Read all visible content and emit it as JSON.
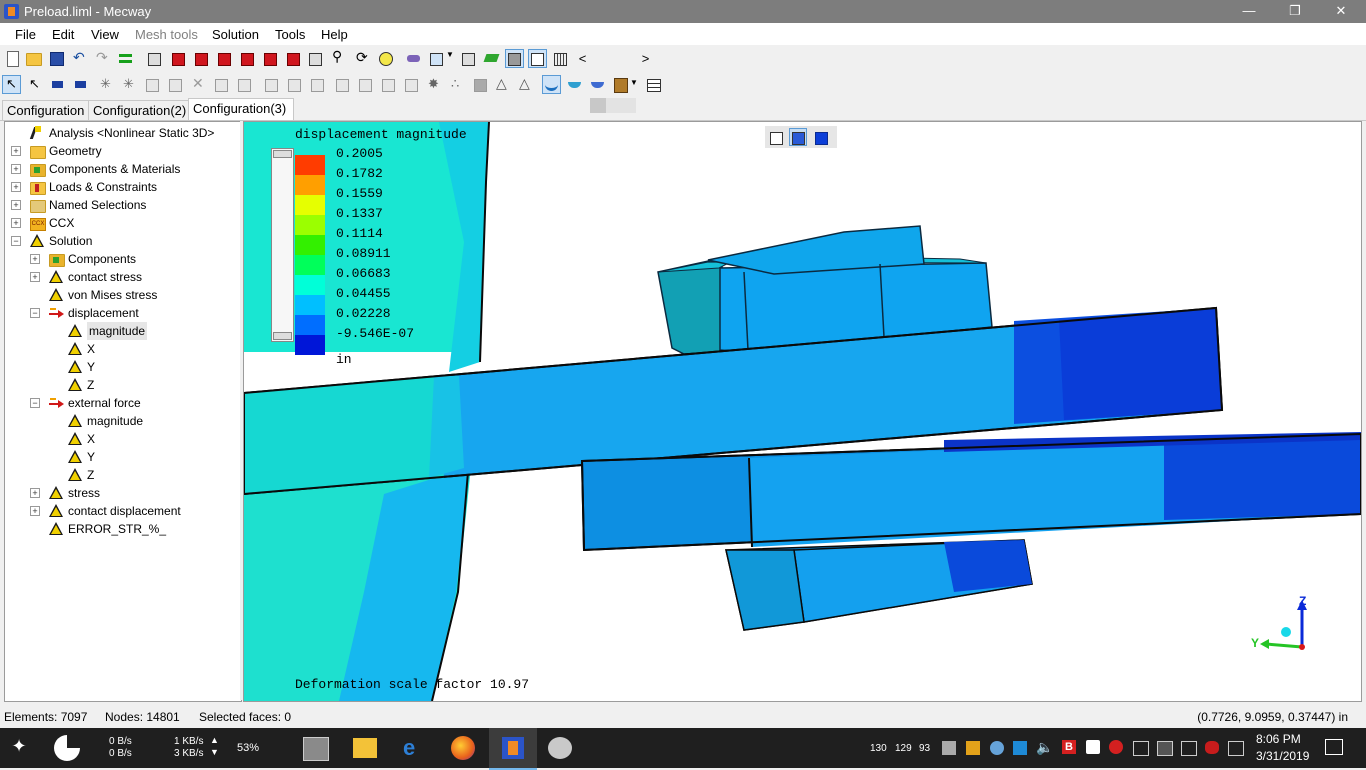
{
  "window": {
    "title": "Preload.liml - Mecway",
    "minimize_glyph": "—",
    "restore_glyph": "❐",
    "close_glyph": "✕"
  },
  "menu": [
    {
      "label": "File",
      "enabled": true
    },
    {
      "label": "Edit",
      "enabled": true
    },
    {
      "label": "View",
      "enabled": true
    },
    {
      "label": "Mesh tools",
      "enabled": false
    },
    {
      "label": "Solution",
      "enabled": true
    },
    {
      "label": "Tools",
      "enabled": true
    },
    {
      "label": "Help",
      "enabled": true
    }
  ],
  "toolbar1": {
    "icons": [
      "new-file-icon",
      "open-folder-icon",
      "save-icon",
      "undo-icon",
      "redo-icon",
      "stack-icon",
      "view-iso-icon",
      "view-front-icon",
      "view-back-icon",
      "view-left-icon",
      "view-right-icon",
      "view-top-icon",
      "view-bottom-icon",
      "zoom-fit-icon",
      "zoom-icon",
      "rotate-icon",
      "pan-icon",
      "layers-icon",
      "select-filter-icon",
      "shade-icon",
      "solid-view-icon",
      "wire-view-icon",
      "mesh-view-icon",
      "scroll-left-icon",
      "scroll-right-icon"
    ],
    "scroll_left": "<",
    "scroll_right": ">"
  },
  "toolbar2": {
    "icons": [
      "select-pointer-icon",
      "select-node-icon",
      "select-edge-icon",
      "select-face-icon",
      "explode-icon",
      "box-icon",
      "solid-icon",
      "delete-icon",
      "split-icon",
      "extrude-icon",
      "copy-icon",
      "mirror-icon",
      "move-icon",
      "rotate-elements-icon",
      "revolve-icon",
      "sweep-icon",
      "refine-icon",
      "merge-icon",
      "tri-icon",
      "tri-outline-icon",
      "warp-active-icon",
      "warp-icon",
      "animate-icon",
      "film-icon",
      "table-icon"
    ]
  },
  "tabs": [
    {
      "label": "Configuration",
      "active": false
    },
    {
      "label": "Configuration(2)",
      "active": false
    },
    {
      "label": "Configuration(3)",
      "active": true
    }
  ],
  "tree": [
    {
      "label": "Analysis <Nonlinear Static 3D>",
      "level": 0,
      "expander": "",
      "icon": "analysis"
    },
    {
      "label": "Geometry",
      "level": 0,
      "expander": "+",
      "icon": "folder"
    },
    {
      "label": "Components & Materials",
      "level": 0,
      "expander": "+",
      "icon": "components"
    },
    {
      "label": "Loads & Constraints",
      "level": 0,
      "expander": "+",
      "icon": "loads"
    },
    {
      "label": "Named Selections",
      "level": 0,
      "expander": "+",
      "icon": "named"
    },
    {
      "label": "CCX",
      "level": 0,
      "expander": "+",
      "icon": "ccx"
    },
    {
      "label": "Solution",
      "level": 0,
      "expander": "-",
      "icon": "tri"
    },
    {
      "label": "Components",
      "level": 1,
      "expander": "+",
      "icon": "components"
    },
    {
      "label": "contact stress",
      "level": 1,
      "expander": "+",
      "icon": "tri"
    },
    {
      "label": "von Mises stress",
      "level": 1,
      "expander": "",
      "icon": "tri"
    },
    {
      "label": "displacement",
      "level": 1,
      "expander": "-",
      "icon": "arrow"
    },
    {
      "label": "magnitude",
      "level": 2,
      "expander": "",
      "icon": "tri",
      "selected": true
    },
    {
      "label": "X",
      "level": 2,
      "expander": "",
      "icon": "tri"
    },
    {
      "label": "Y",
      "level": 2,
      "expander": "",
      "icon": "tri"
    },
    {
      "label": "Z",
      "level": 2,
      "expander": "",
      "icon": "tri"
    },
    {
      "label": "external force",
      "level": 1,
      "expander": "-",
      "icon": "arrow"
    },
    {
      "label": "magnitude",
      "level": 2,
      "expander": "",
      "icon": "tri"
    },
    {
      "label": "X",
      "level": 2,
      "expander": "",
      "icon": "tri"
    },
    {
      "label": "Y",
      "level": 2,
      "expander": "",
      "icon": "tri"
    },
    {
      "label": "Z",
      "level": 2,
      "expander": "",
      "icon": "tri"
    },
    {
      "label": "stress",
      "level": 1,
      "expander": "+",
      "icon": "tri"
    },
    {
      "label": "contact displacement",
      "level": 1,
      "expander": "+",
      "icon": "tri"
    },
    {
      "label": "ERROR_STR_%_",
      "level": 1,
      "expander": "",
      "icon": "tri"
    }
  ],
  "viewport": {
    "legend_title": "displacement magnitude",
    "legend_values": [
      "0.2005",
      "0.1782",
      "0.1559",
      "0.1337",
      "0.1114",
      "0.08911",
      "0.06683",
      "0.04455",
      "0.02228",
      "-9.546E-07"
    ],
    "legend_colors": [
      "#ff3c00",
      "#ff9f00",
      "#e6ff00",
      "#9bff00",
      "#33f000",
      "#00ff5a",
      "#00ffd8",
      "#00bfff",
      "#006eff",
      "#0016d8"
    ],
    "legend_unit": "in",
    "deformation_text": "Deformation scale factor 10.97",
    "axis_labels": {
      "z": "Z",
      "y": "Y"
    },
    "view_buttons": [
      "view-box-outline-icon",
      "view-box-half-icon",
      "view-box-solid-icon"
    ]
  },
  "status": {
    "elements": "Elements: 7097",
    "nodes": "Nodes: 14801",
    "selected_faces": "Selected faces: 0",
    "coordinates": "(0.7726, 9.0959, 0.37447) in"
  },
  "taskbar": {
    "net_up": "0 B/s",
    "net_down": "0 B/s",
    "rate_up": "1 KB/s",
    "rate_down": "3 KB/s",
    "cpu": "53%",
    "tray_numbers": [
      "130",
      "129",
      "93"
    ],
    "time": "8:06 PM",
    "date": "3/31/2019"
  }
}
